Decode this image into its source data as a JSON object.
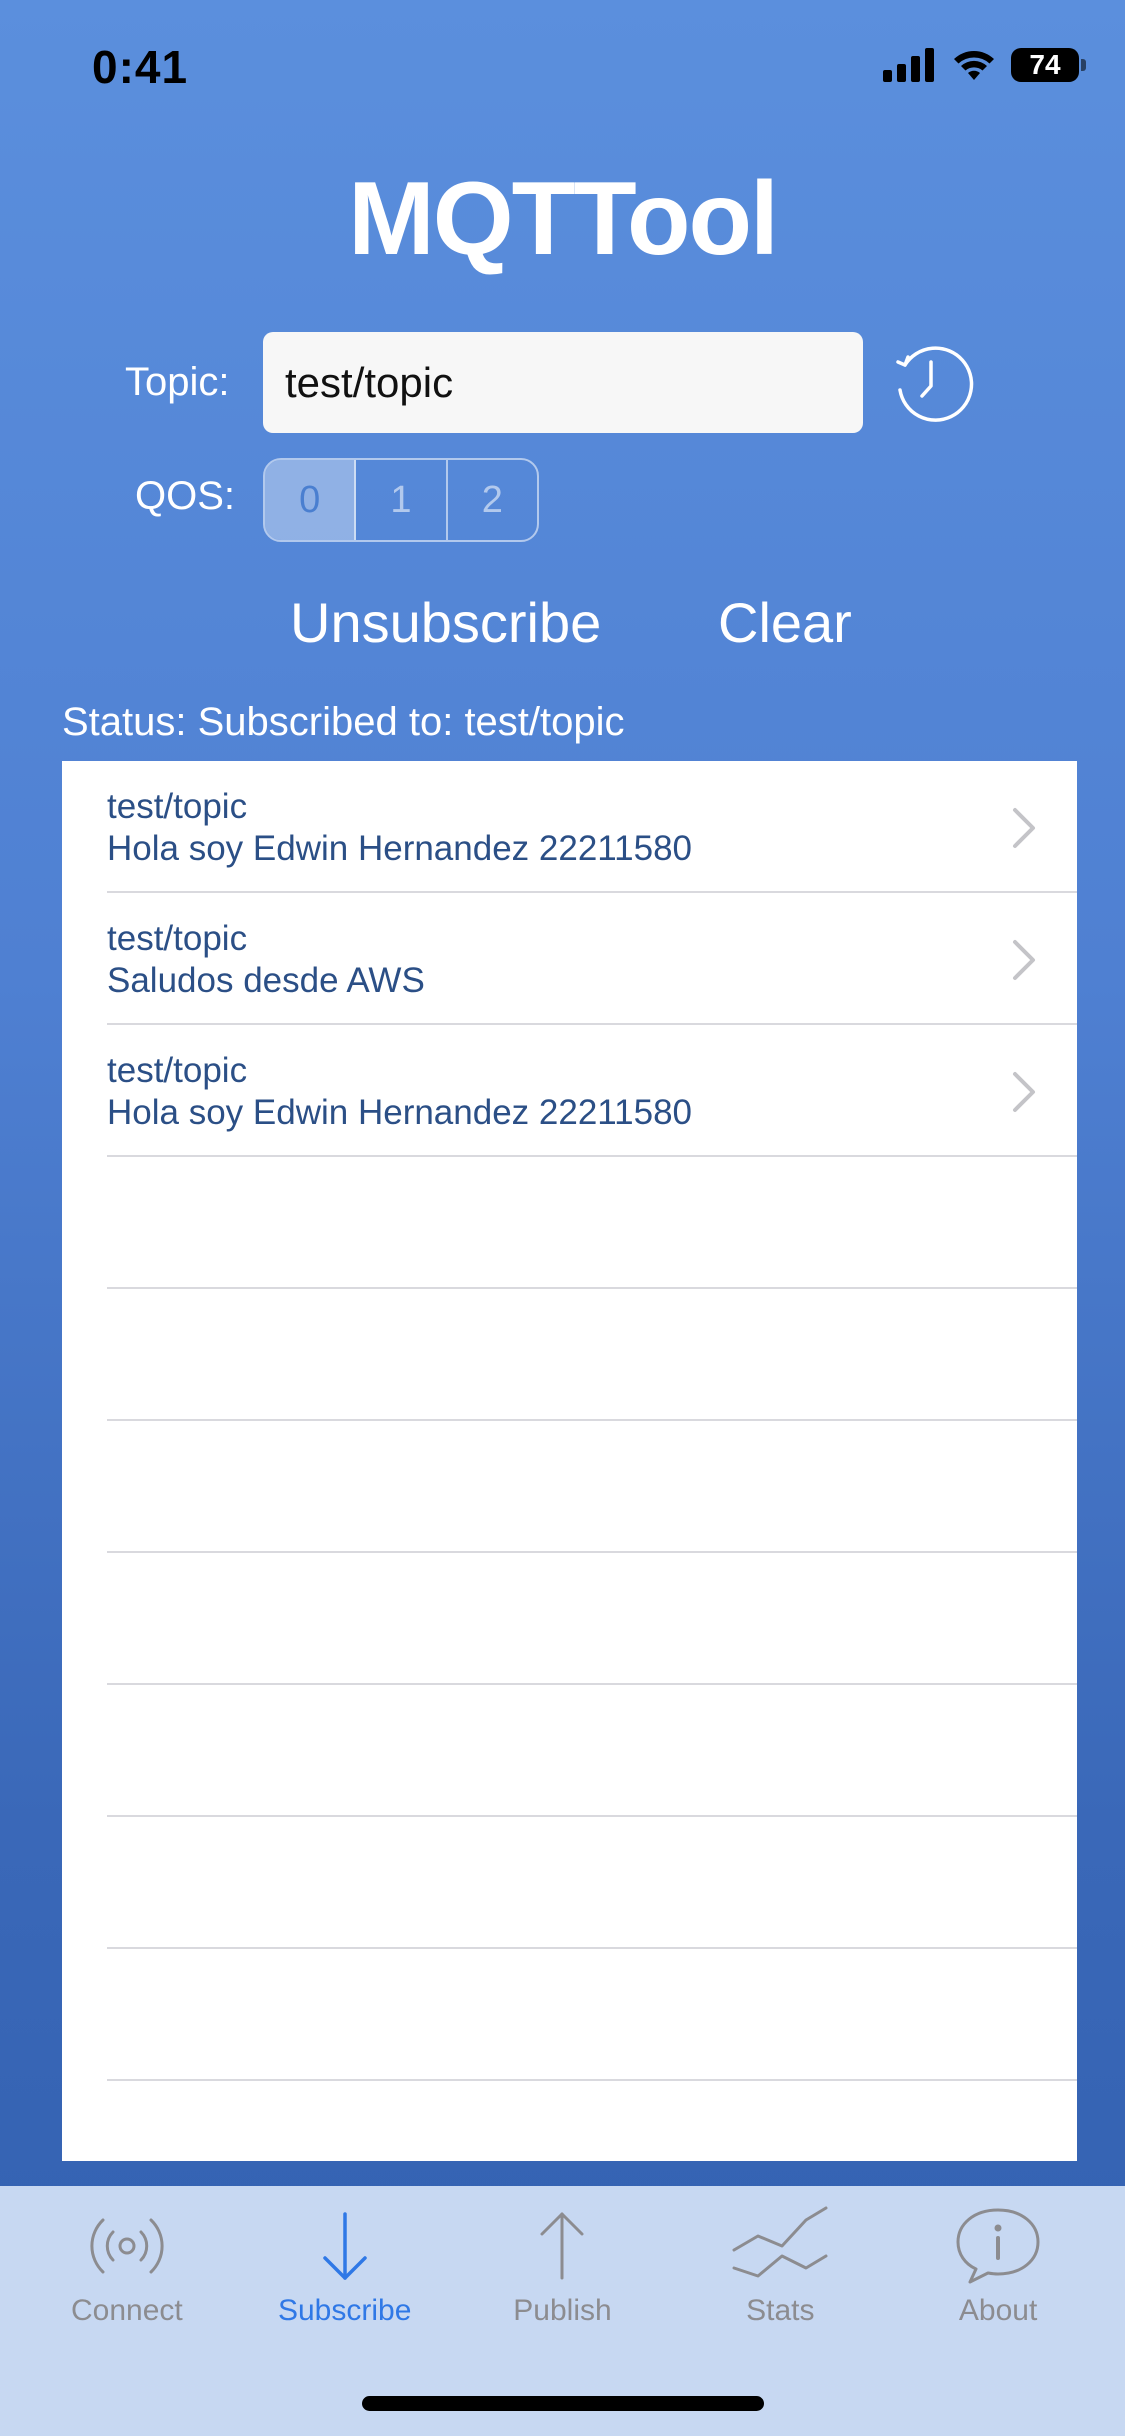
{
  "status_bar": {
    "time": "0:41",
    "battery": "74",
    "icons": [
      "signal-icon",
      "wifi-icon",
      "battery-icon"
    ]
  },
  "app": {
    "title": "MQTTool"
  },
  "form": {
    "topic_label": "Topic:",
    "topic_value": "test/topic",
    "qos_label": "QOS:",
    "qos_options": [
      "0",
      "1",
      "2"
    ],
    "qos_selected": "0",
    "unsubscribe_label": "Unsubscribe",
    "clear_label": "Clear",
    "status_text": "Status: Subscribed to: test/topic"
  },
  "messages": [
    {
      "topic": "test/topic",
      "text": "Hola soy Edwin Hernandez 22211580"
    },
    {
      "topic": "test/topic",
      "text": "Saludos desde AWS"
    },
    {
      "topic": "test/topic",
      "text": "Hola soy Edwin Hernandez 22211580"
    }
  ],
  "tabs": [
    {
      "label": "Connect",
      "icon": "broadcast-icon",
      "active": false
    },
    {
      "label": "Subscribe",
      "icon": "arrow-down-icon",
      "active": true
    },
    {
      "label": "Publish",
      "icon": "arrow-up-icon",
      "active": false
    },
    {
      "label": "Stats",
      "icon": "chart-lines-icon",
      "active": false
    },
    {
      "label": "About",
      "icon": "info-bubble-icon",
      "active": false
    }
  ],
  "colors": {
    "accent": "#2f78e6",
    "background_top": "#5b8fdd",
    "background_bottom": "#3260b0",
    "tab_bar": "#c7d8f2",
    "message_text": "#2b4f86"
  }
}
